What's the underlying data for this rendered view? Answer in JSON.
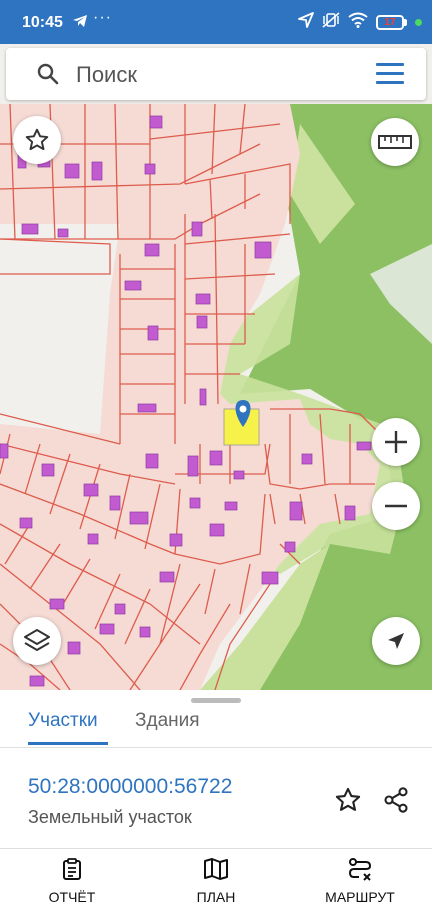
{
  "status_bar": {
    "time": "10:45",
    "more": "···",
    "battery": "17"
  },
  "search": {
    "placeholder": "Поиск"
  },
  "sheet": {
    "tabs": [
      {
        "label": "Участки",
        "active": true
      },
      {
        "label": "Здания",
        "active": false
      }
    ],
    "parcel": {
      "cadastral_number": "50:28:0000000:56722",
      "type": "Земельный участок"
    }
  },
  "bottom_nav": [
    {
      "label": "ОТЧЁТ",
      "icon": "report-icon"
    },
    {
      "label": "ПЛАН",
      "icon": "map-plan-icon"
    },
    {
      "label": "МАРШРУТ",
      "icon": "route-icon"
    }
  ],
  "colors": {
    "accent": "#2f74c0",
    "forest": "#8cc063",
    "forest_light": "#c9e19c",
    "parcel_fill": "#f5dbd4",
    "parcel_line": "#de5c4d",
    "building": "#c35bd0",
    "selected": "#f7f24a"
  }
}
